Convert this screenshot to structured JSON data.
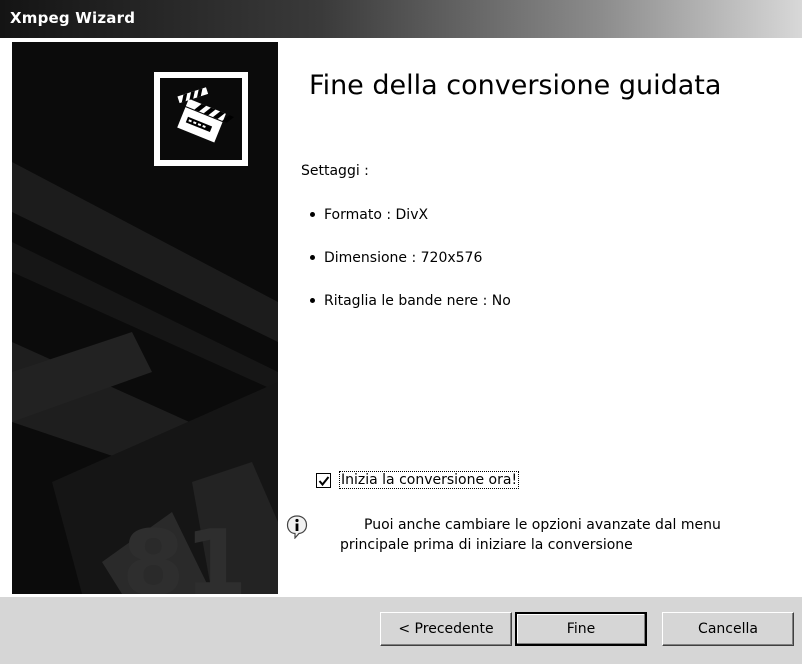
{
  "window": {
    "title": "Xmpeg Wizard"
  },
  "main": {
    "heading": "Fine della conversione guidata",
    "settings_label": "Settaggi :",
    "settings": [
      {
        "text": "Formato : DivX"
      },
      {
        "text": "Dimensione : 720x576"
      },
      {
        "text": "Ritaglia le bande nere : No"
      }
    ],
    "start_checkbox": {
      "label": "Inizia la conversione ora!",
      "checked": true
    },
    "info": {
      "line1": "Puoi anche cambiare le opzioni avanzate dal menu",
      "line2": "principale prima di iniziare la conversione"
    }
  },
  "buttons": {
    "back": "< Precedente",
    "finish": "Fine",
    "cancel": "Cancella"
  },
  "icons": {
    "logo": "clapperboard-icon",
    "info": "info-icon",
    "check": "checkmark-icon"
  }
}
